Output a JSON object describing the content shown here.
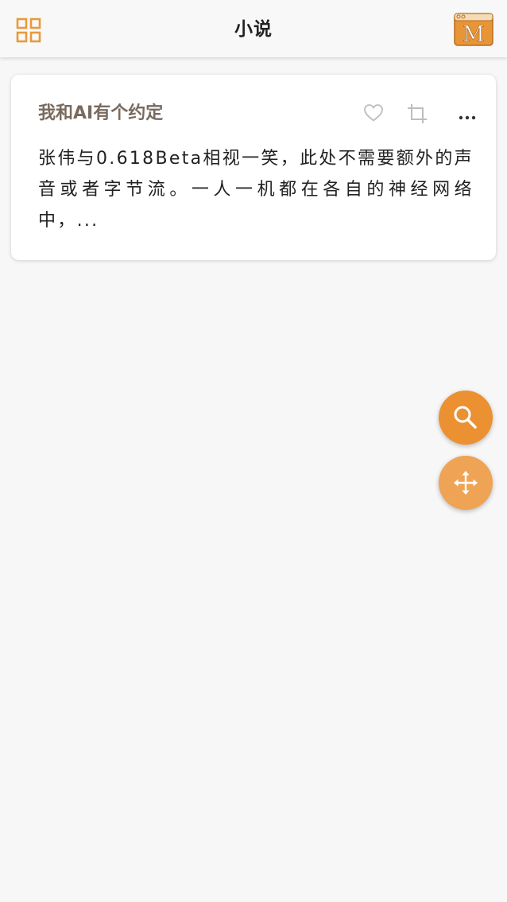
{
  "header": {
    "title": "小说",
    "menu_icon": "grid-icon",
    "logo_letter": "M",
    "accent_color": "#e99a3c"
  },
  "cards": [
    {
      "title": "我和AI有个约定",
      "excerpt": "张伟与0.618Beta相视一笑，此处不需要额外的声音或者字节流。一人一机都在各自的神经网络中，...",
      "actions": [
        "heart-icon",
        "crop-icon",
        "more-icon"
      ]
    }
  ],
  "fabs": {
    "search_icon": "search-icon",
    "move_icon": "move-icon",
    "search_color": "#eb9131",
    "move_color": "#eea454"
  }
}
